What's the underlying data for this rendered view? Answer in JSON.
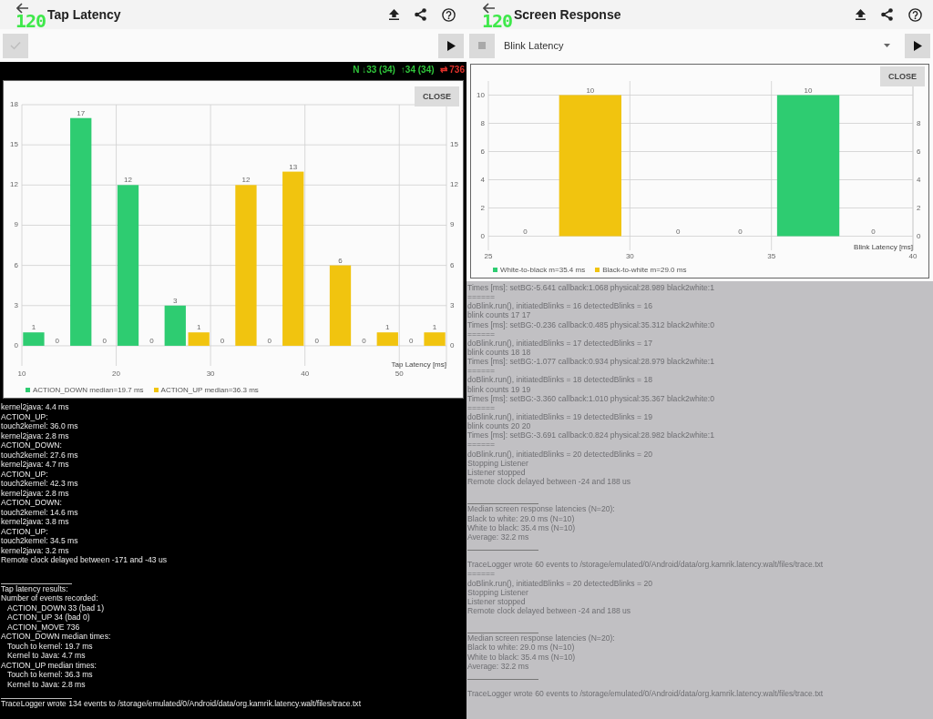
{
  "panels": [
    {
      "title": "Tap Latency",
      "overlay": "120",
      "toolbar": {
        "start_button": {
          "kind": "check"
        }
      },
      "status": [
        {
          "text": "N ↓33 (34)",
          "color": "#2fc43a"
        },
        {
          "text": "↑34 (34)",
          "color": "#2fc43a"
        },
        {
          "text": "⇄ 736",
          "color": "#e0302a"
        }
      ],
      "chart": {
        "close": "CLOSE",
        "chart_data": {
          "type": "bar",
          "xlabel": "Tap Latency [ms]",
          "x": [
            11.25,
            13.75,
            16.25,
            18.75,
            21.25,
            23.75,
            26.25,
            28.75,
            31.25,
            33.75,
            36.25,
            38.75,
            41.25,
            43.75,
            46.25,
            48.75,
            51.25,
            53.75
          ],
          "series": [
            {
              "name": "ACTION_DOWN median=19.7 ms",
              "color": "#2ecc71",
              "values": [
                1,
                0,
                17,
                0,
                12,
                0,
                3,
                null,
                null,
                null,
                null,
                null,
                null,
                null,
                null,
                null,
                null,
                null
              ]
            },
            {
              "name": "ACTION_UP median=36.3 ms",
              "color": "#f1c40f",
              "values": [
                null,
                null,
                null,
                null,
                null,
                null,
                null,
                1,
                0,
                12,
                0,
                13,
                0,
                6,
                0,
                1,
                0,
                1
              ]
            }
          ],
          "xlim": [
            10,
            55
          ],
          "ylim": [
            -1.5,
            18
          ],
          "xticks": [
            10,
            20,
            30,
            40,
            50
          ],
          "yticks": [
            0,
            3,
            6,
            9,
            12,
            15,
            18
          ],
          "grid": true,
          "data_labels": true
        },
        "right_axis_labels": [
          "15",
          "12",
          "9",
          "6",
          "3",
          "0"
        ]
      },
      "log": {
        "kind": "dark",
        "lines": [
          {
            "kind": "text",
            "text": "kernel2java: 4.4 ms"
          },
          {
            "kind": "text",
            "text": "ACTION_UP:"
          },
          {
            "kind": "text",
            "text": "touch2kernel: 36.0 ms"
          },
          {
            "kind": "text",
            "text": "kernel2java: 2.8 ms"
          },
          {
            "kind": "text",
            "text": "ACTION_DOWN:"
          },
          {
            "kind": "text",
            "text": "touch2kernel: 27.6 ms"
          },
          {
            "kind": "text",
            "text": "kernel2java: 4.7 ms"
          },
          {
            "kind": "text",
            "text": "ACTION_UP:"
          },
          {
            "kind": "text",
            "text": "touch2kernel: 42.3 ms"
          },
          {
            "kind": "text",
            "text": "kernel2java: 2.8 ms"
          },
          {
            "kind": "text",
            "text": "ACTION_DOWN:"
          },
          {
            "kind": "text",
            "text": "touch2kernel: 14.6 ms"
          },
          {
            "kind": "text",
            "text": "kernel2java: 3.8 ms"
          },
          {
            "kind": "text",
            "text": "ACTION_UP:"
          },
          {
            "kind": "text",
            "text": "touch2kernel: 34.5 ms"
          },
          {
            "kind": "text",
            "text": "kernel2java: 3.2 ms"
          },
          {
            "kind": "text",
            "text": "Remote clock delayed between -171 and -43 us"
          },
          {
            "kind": "blank"
          },
          {
            "kind": "rule"
          },
          {
            "kind": "text",
            "text": "Tap latency results:"
          },
          {
            "kind": "text",
            "text": "Number of events recorded:"
          },
          {
            "kind": "indent",
            "text": "ACTION_DOWN 33 (bad 1)"
          },
          {
            "kind": "indent",
            "text": "ACTION_UP 34 (bad 0)"
          },
          {
            "kind": "indent",
            "text": "ACTION_MOVE 736"
          },
          {
            "kind": "text",
            "text": "ACTION_DOWN median times:"
          },
          {
            "kind": "indent",
            "text": "Touch to kernel: 19.7 ms"
          },
          {
            "kind": "indent",
            "text": "Kernel to Java: 4.7 ms"
          },
          {
            "kind": "text",
            "text": "ACTION_UP median times:"
          },
          {
            "kind": "indent",
            "text": "Touch to kernel: 36.3 ms"
          },
          {
            "kind": "indent",
            "text": "Kernel to Java: 2.8 ms"
          },
          {
            "kind": "rule"
          },
          {
            "kind": "text",
            "text": "TraceLogger wrote 134 events to /storage/emulated/0/Android/data/org.kamrik.latency.walt/files/trace.txt"
          }
        ]
      }
    },
    {
      "title": "Screen Response",
      "overlay": "120",
      "toolbar": {
        "start_button": {
          "kind": "stop"
        },
        "dropdown": "Blink Latency"
      },
      "chart": {
        "close": "CLOSE",
        "chart_data": {
          "type": "bar",
          "xlabel": "Blink Latency [ms]",
          "x": [
            26.3,
            28.6,
            31.7,
            33.9,
            36.3,
            38.6
          ],
          "series": [
            {
              "name": "White-to-black m=35.4 ms",
              "color": "#2ecc71",
              "values": [
                null,
                null,
                null,
                0,
                10,
                0
              ]
            },
            {
              "name": "Black-to-white m=29.0 ms",
              "color": "#f1c40f",
              "values": [
                0,
                10,
                0,
                null,
                null,
                null
              ]
            }
          ],
          "xlim": [
            25,
            40
          ],
          "ylim": [
            -1,
            11
          ],
          "xticks": [
            25,
            30,
            35,
            40
          ],
          "yticks": [
            0,
            2,
            4,
            6,
            8,
            10
          ],
          "grid": true,
          "data_labels": true
        },
        "right_axis_labels": [
          "8",
          "6",
          "4",
          "2",
          "0"
        ]
      },
      "log": {
        "kind": "light",
        "lines": [
          {
            "kind": "text",
            "text": "Times [ms]: setBG:-5.641 callback:1.068 physical:28.989 black2white:1"
          },
          {
            "kind": "text",
            "text": "======"
          },
          {
            "kind": "text",
            "text": "doBlink.run(), initiatedBlinks = 16 detectedBlinks = 16"
          },
          {
            "kind": "text",
            "text": "blink counts 17 17"
          },
          {
            "kind": "text",
            "text": "Times [ms]: setBG:-0.236 callback:0.485 physical:35.312 black2white:0"
          },
          {
            "kind": "text",
            "text": "======"
          },
          {
            "kind": "text",
            "text": "doBlink.run(), initiatedBlinks = 17 detectedBlinks = 17"
          },
          {
            "kind": "text",
            "text": "blink counts 18 18"
          },
          {
            "kind": "text",
            "text": "Times [ms]: setBG:-1.077 callback:0.934 physical:28.979 black2white:1"
          },
          {
            "kind": "text",
            "text": "======"
          },
          {
            "kind": "text",
            "text": "doBlink.run(), initiatedBlinks = 18 detectedBlinks = 18"
          },
          {
            "kind": "text",
            "text": "blink counts 19 19"
          },
          {
            "kind": "text",
            "text": "Times [ms]: setBG:-3.360 callback:1.010 physical:35.367 black2white:0"
          },
          {
            "kind": "text",
            "text": "======"
          },
          {
            "kind": "text",
            "text": "doBlink.run(), initiatedBlinks = 19 detectedBlinks = 19"
          },
          {
            "kind": "text",
            "text": "blink counts 20 20"
          },
          {
            "kind": "text",
            "text": "Times [ms]: setBG:-3.691 callback:0.824 physical:28.982 black2white:1"
          },
          {
            "kind": "text",
            "text": "======"
          },
          {
            "kind": "text",
            "text": "doBlink.run(), initiatedBlinks = 20 detectedBlinks = 20"
          },
          {
            "kind": "text",
            "text": "Stopping Listener"
          },
          {
            "kind": "text",
            "text": "Listener stopped"
          },
          {
            "kind": "text",
            "text": "Remote clock delayed between -24 and 188 us"
          },
          {
            "kind": "blank"
          },
          {
            "kind": "rule"
          },
          {
            "kind": "text",
            "text": "Median screen response latencies (N=20):"
          },
          {
            "kind": "text",
            "text": "Black to white: 29.0 ms (N=10)"
          },
          {
            "kind": "text",
            "text": "White to black: 35.4 ms (N=10)"
          },
          {
            "kind": "text",
            "text": "Average: 32.2 ms"
          },
          {
            "kind": "rule"
          },
          {
            "kind": "blank"
          },
          {
            "kind": "text",
            "text": "TraceLogger wrote 60 events to /storage/emulated/0/Android/data/org.kamrik.latency.walt/files/trace.txt"
          },
          {
            "kind": "text",
            "text": "======"
          },
          {
            "kind": "text",
            "text": "doBlink.run(), initiatedBlinks = 20 detectedBlinks = 20"
          },
          {
            "kind": "text",
            "text": "Stopping Listener"
          },
          {
            "kind": "text",
            "text": "Listener stopped"
          },
          {
            "kind": "text",
            "text": "Remote clock delayed between -24 and 188 us"
          },
          {
            "kind": "blank"
          },
          {
            "kind": "rule"
          },
          {
            "kind": "text",
            "text": "Median screen response latencies (N=20):"
          },
          {
            "kind": "text",
            "text": "Black to white: 29.0 ms (N=10)"
          },
          {
            "kind": "text",
            "text": "White to black: 35.4 ms (N=10)"
          },
          {
            "kind": "text",
            "text": "Average: 32.2 ms"
          },
          {
            "kind": "rule"
          },
          {
            "kind": "blank"
          },
          {
            "kind": "text",
            "text": "TraceLogger wrote 60 events to /storage/emulated/0/Android/data/org.kamrik.latency.walt/files/trace.txt"
          }
        ]
      }
    }
  ]
}
